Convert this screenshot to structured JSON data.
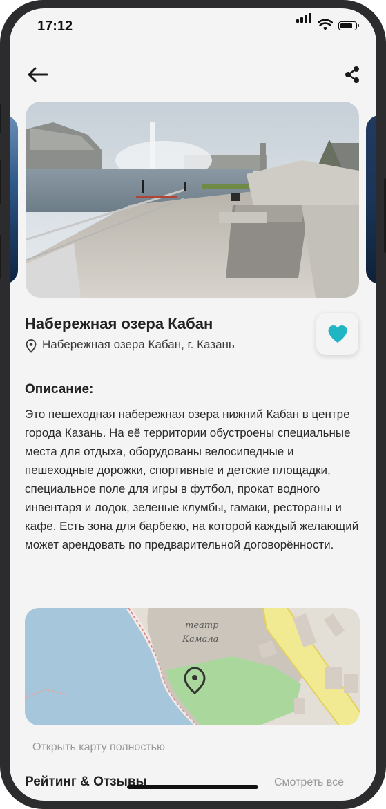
{
  "status_bar": {
    "time": "17:12"
  },
  "header": {
    "back_icon": "arrow-left-icon",
    "share_icon": "share-icon"
  },
  "place": {
    "title": "Набережная озера Кабан",
    "location": "Набережная озера Кабан, г. Казань",
    "favorite": true,
    "favorite_color": "#1fb5c2"
  },
  "description": {
    "heading": "Описание:",
    "text": "Это пешеходная набережная озера нижний Кабан в центре города Казань. На её территории обустроены специальные места для отдыха, оборудованы велосипедные и пешеходные дорожки, спортивные и детские площадки, специальное поле для игры в футбол, прокат водного инвентаря и лодок, зеленые клумбы, гамаки, рестораны и кафе. Есть зона для барбекю, на которой каждый желающий может арендовать по предварительной договорённости."
  },
  "map": {
    "label_line1": "театр",
    "label_line2": "Камала",
    "open_link": "Открыть карту полностью"
  },
  "reviews": {
    "heading": "Рейтинг & Отзывы",
    "see_all": "Смотреть все"
  }
}
